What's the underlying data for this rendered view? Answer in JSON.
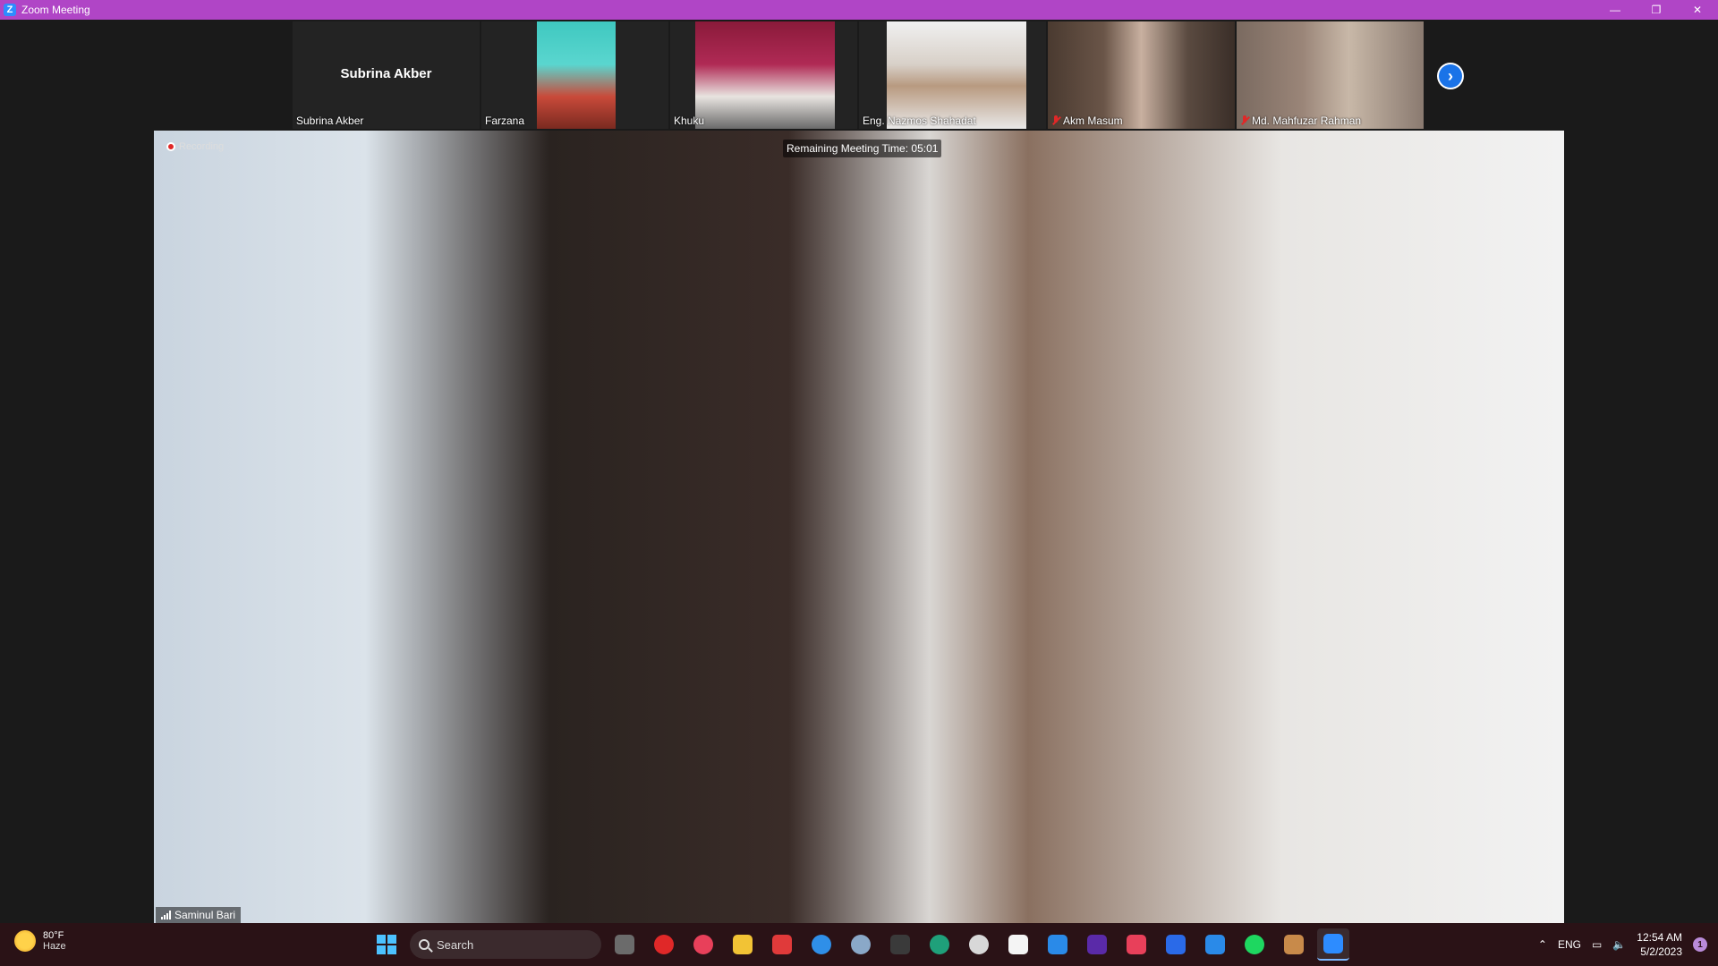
{
  "window": {
    "title": "Zoom Meeting",
    "minimize": "—",
    "restore": "❐",
    "close": "✕"
  },
  "gallery": {
    "tiles": [
      {
        "big_name": "Subrina Akber",
        "name": "Subrina Akber",
        "muted": false
      },
      {
        "name": "Farzana",
        "muted": false
      },
      {
        "name": "Khuku",
        "muted": false
      },
      {
        "name": "Eng. Nazmos Shahadat",
        "muted": false
      },
      {
        "name": "Akm Masum",
        "muted": true
      },
      {
        "name": "Md. Mahfuzar Rahman",
        "muted": true
      }
    ],
    "next_glyph": "›"
  },
  "main": {
    "recording_label": "Recording",
    "remaining_time": "Remaining Meeting Time: 05:01",
    "speaker_name": "Saminul Bari"
  },
  "taskbar": {
    "weather_temp": "80°F",
    "weather_desc": "Haze",
    "search_label": "Search",
    "language": "ENG",
    "time": "12:54 AM",
    "date": "5/2/2023",
    "notification_count": "1"
  },
  "colors": {
    "titlebar": "#b045c6",
    "zoom_blue": "#2d8cff",
    "taskbar": "#2a1216"
  }
}
